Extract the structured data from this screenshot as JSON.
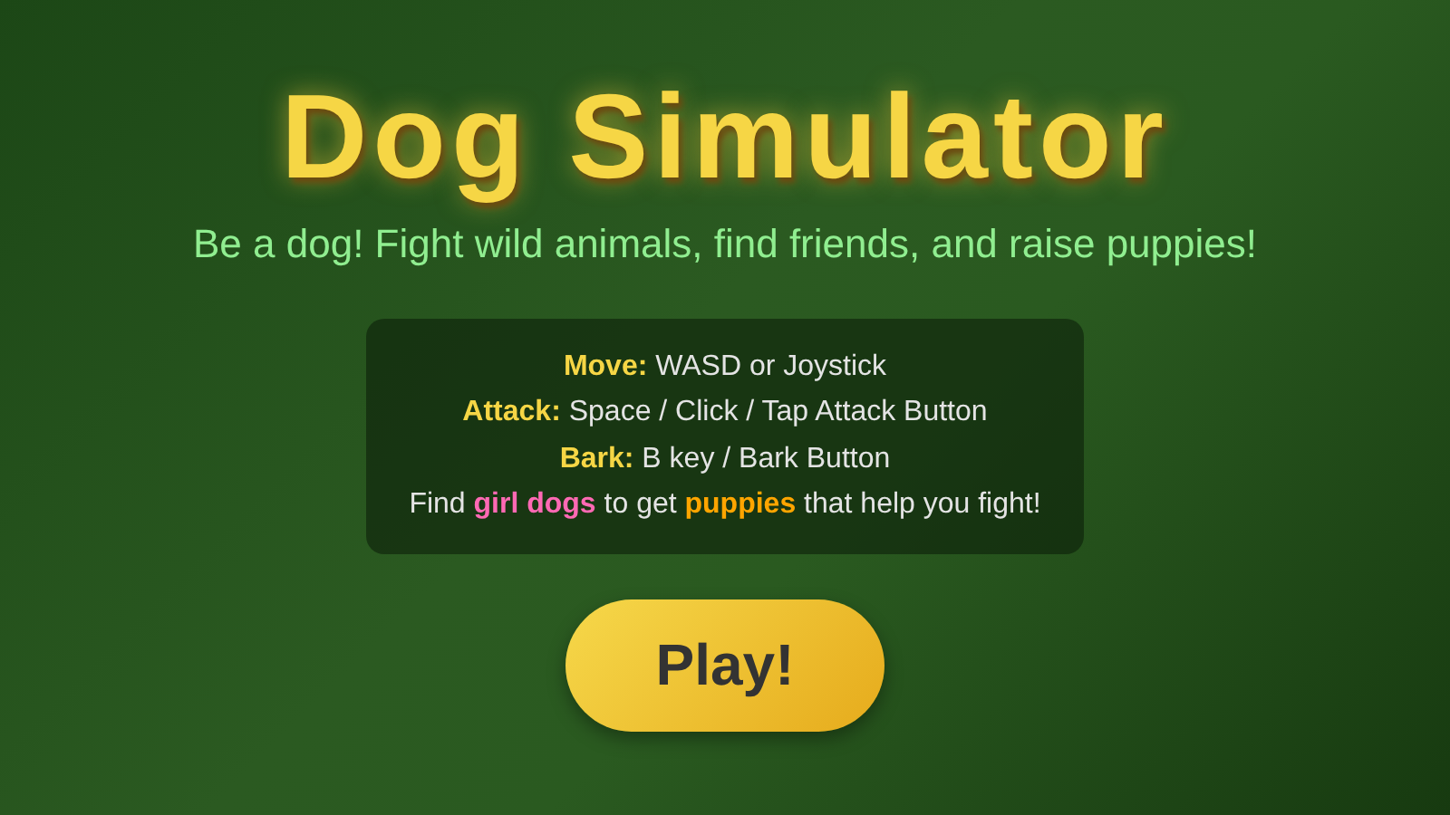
{
  "title": "Dog Simulator",
  "subtitle": "Be a dog! Fight wild animals, find friends, and raise puppies!",
  "instructions": [
    [
      {
        "text": "Move:",
        "kind": "key"
      },
      {
        "text": " WASD or Joystick",
        "kind": "plain"
      }
    ],
    [
      {
        "text": "Attack:",
        "kind": "key"
      },
      {
        "text": " Space / Click / Tap Attack Button",
        "kind": "plain"
      }
    ],
    [
      {
        "text": "Bark:",
        "kind": "key"
      },
      {
        "text": " B key / Bark Button",
        "kind": "plain"
      }
    ],
    [
      {
        "text": "Find ",
        "kind": "plain"
      },
      {
        "text": "girl dogs",
        "kind": "accent",
        "color": "#ff69b4"
      },
      {
        "text": " to get ",
        "kind": "plain"
      },
      {
        "text": "puppies",
        "kind": "accent",
        "color": "#ffa500"
      },
      {
        "text": " that help you fight!",
        "kind": "plain"
      }
    ]
  ],
  "play_button": "Play!"
}
